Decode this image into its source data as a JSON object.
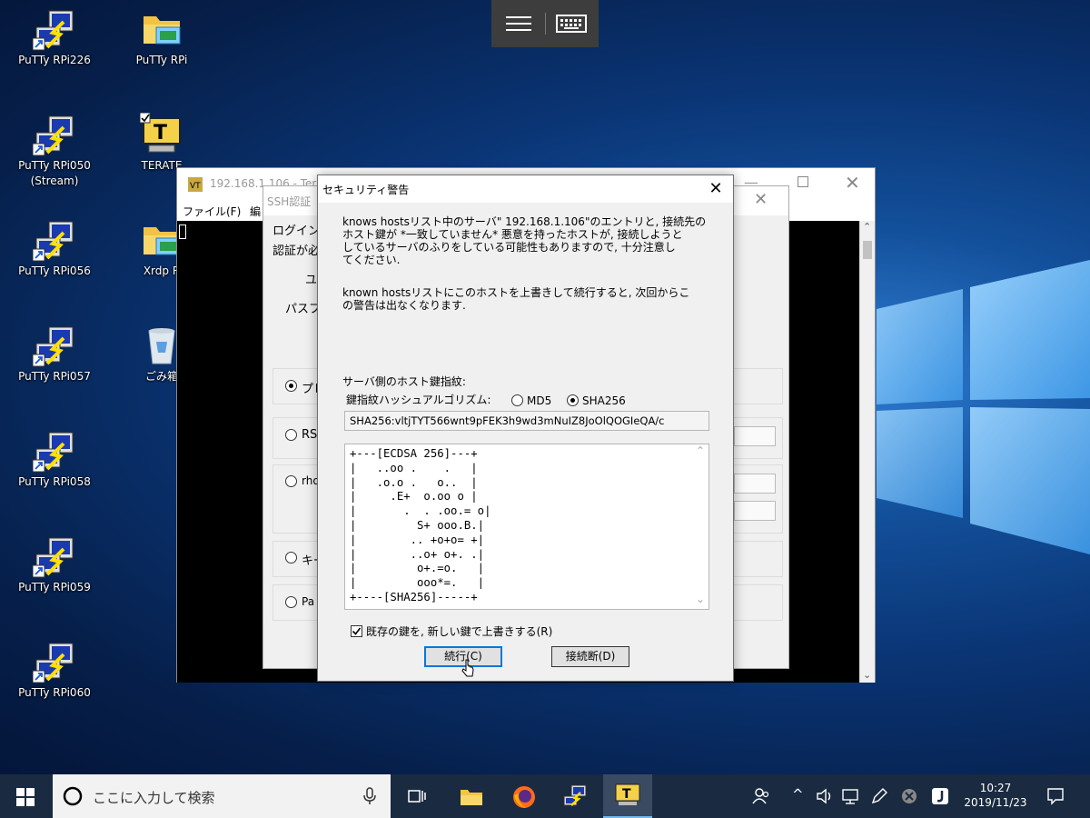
{
  "desktop": {
    "icons_col1": [
      {
        "label": "PuTTy RPi226"
      },
      {
        "label": "PuTTy RPi050 (Stream)"
      },
      {
        "label": "PuTTy RPi056"
      },
      {
        "label": "PuTTy RPi057"
      },
      {
        "label": "PuTTy RPi058"
      },
      {
        "label": "PuTTy RPi059"
      },
      {
        "label": "PuTTy RPi060"
      }
    ],
    "icons_col2": [
      {
        "label": "PuTTy RPi"
      },
      {
        "label": "TERATE"
      },
      {
        "label": "Xrdp R"
      },
      {
        "label": "ごみ箱"
      }
    ]
  },
  "teraterm": {
    "title": "192.168.1.106 - Tera",
    "menu": [
      "ファイル(F)",
      "編"
    ]
  },
  "ssh_dialog": {
    "title": "SSH認証",
    "line1": "ログイン",
    "line2": "認証が必",
    "label_user": "ユ",
    "label_pass": "パスフ",
    "opt1": "プレ",
    "opt2": "RS",
    "opt3": "rho",
    "opt4": "キー",
    "opt5": "Pa"
  },
  "security": {
    "title": "セキュリティ警告",
    "warning_lines": [
      "knows hostsリスト中のサーバ\" 192.168.1.106\"のエントリと, 接続先の",
      "ホスト鍵が *一致していません* 悪意を持ったホストが, 接続しようと",
      "しているサーバのふりをしている可能性もありますので, 十分注意し",
      "てください."
    ],
    "overwrite_lines": [
      "known hostsリストにこのホストを上書きして続行すると, 次回からこ",
      "の警告は出なくなります."
    ],
    "fingerprint_label": "サーバ側のホスト鍵指紋:",
    "hash_label": "鍵指紋ハッシュアルゴリズム:",
    "md5_label": "MD5",
    "sha256_label": "SHA256",
    "selected_hash": "SHA256",
    "fingerprint": "SHA256:vltjTYT566wnt9pFEK3h9wd3mNuIZ8JoOlQOGIeQA/c",
    "randomart": "+---[ECDSA 256]---+\n|   ..oo .    .   |\n|   .o.o .   o..  |\n|     .E+  o.oo o |\n|       .  . .oo.= o|\n|         S+ ooo.B.|\n|        .. +o+o= +|\n|        ..o+ o+. .|\n|         o+.=o.   |\n|         ooo*=.   |\n+----[SHA256]-----+",
    "checkbox_label": "既存の鍵を, 新しい鍵で上書きする(R)",
    "checkbox_checked": true,
    "continue_label": "続行(C)",
    "disconnect_label": "接続断(D)"
  },
  "taskbar": {
    "search_placeholder": "ここに入力して検索",
    "time": "10:27",
    "date": "2019/11/23"
  }
}
